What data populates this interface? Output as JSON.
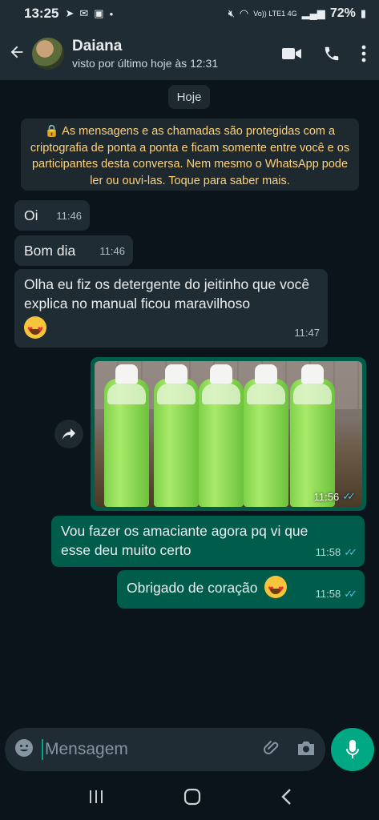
{
  "status_bar": {
    "time": "13:25",
    "network_label": "Vo)) LTE1 4G",
    "battery": "72%"
  },
  "header": {
    "contact_name": "Daiana",
    "last_seen": "visto por último hoje às 12:31",
    "icons": [
      "back-arrow-icon",
      "video-call-icon",
      "phone-icon",
      "more-vert-icon"
    ]
  },
  "chat": {
    "day_label": "Hoje",
    "encryption_notice": "🔒 As mensagens e as chamadas são protegidas com a criptografia de ponta a ponta e ficam somente entre você e os participantes desta conversa. Nem mesmo o WhatsApp pode ler ou ouvi-las. Toque para saber mais.",
    "messages": [
      {
        "direction": "in",
        "text": "Oi",
        "time": "11:46"
      },
      {
        "direction": "in",
        "text": "Bom dia",
        "time": "11:46"
      },
      {
        "direction": "in",
        "text": "Olha eu fiz os detergente do jeitinho que você explica no manual ficou maravilhoso",
        "emoji": "heart-eyes-emoji",
        "time": "11:47"
      },
      {
        "direction": "out",
        "type": "image",
        "time": "11:56",
        "read": true
      },
      {
        "direction": "out",
        "text": "Vou fazer os amaciante agora pq vi que esse deu muito certo",
        "time": "11:58",
        "read": true
      },
      {
        "direction": "out",
        "text": "Obrigado de coração",
        "emoji": "heart-eyes-emoji",
        "time": "11:58",
        "read": true
      }
    ],
    "ticks": "✓✓"
  },
  "composer": {
    "placeholder": "Mensagem"
  },
  "colors": {
    "background": "#0b141a",
    "incoming_bubble": "#202c33",
    "outgoing_bubble": "#005c4b",
    "accent": "#00a884",
    "read_ticks": "#53bdeb",
    "notice_text": "#ffd279"
  }
}
